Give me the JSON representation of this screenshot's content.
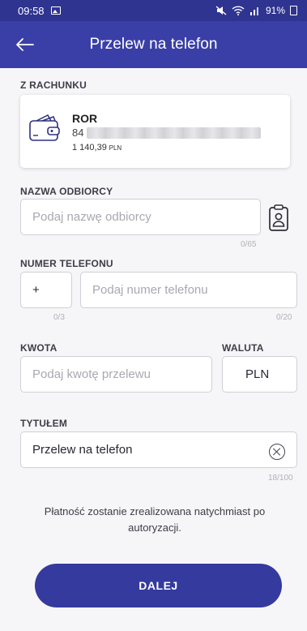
{
  "status_bar": {
    "time": "09:58",
    "battery": "91%"
  },
  "app_bar": {
    "title": "Przelew na telefon"
  },
  "from_account": {
    "label": "Z RACHUNKU",
    "name": "ROR",
    "number_visible": "84",
    "balance": "1 140,39",
    "currency": "PLN"
  },
  "recipient": {
    "label": "NAZWA ODBIORCY",
    "placeholder": "Podaj nazwę odbiorcy",
    "counter": "0/65"
  },
  "phone": {
    "label": "NUMER TELEFONU",
    "prefix_value": "+",
    "prefix_counter": "0/3",
    "placeholder": "Podaj numer telefonu",
    "counter": "0/20"
  },
  "amount": {
    "label": "KWOTA",
    "placeholder": "Podaj kwotę przelewu"
  },
  "currency": {
    "label": "WALUTA",
    "value": "PLN"
  },
  "title_field": {
    "label": "TYTUŁEM",
    "value": "Przelew na telefon",
    "counter": "18/100"
  },
  "info_text": "Płatność zostanie zrealizowana natychmiast po autoryzacji.",
  "next_button": {
    "label": "DALEJ"
  },
  "colors": {
    "header": "#3a3fa7",
    "status_bar": "#2f3490",
    "button": "#343a9e"
  }
}
